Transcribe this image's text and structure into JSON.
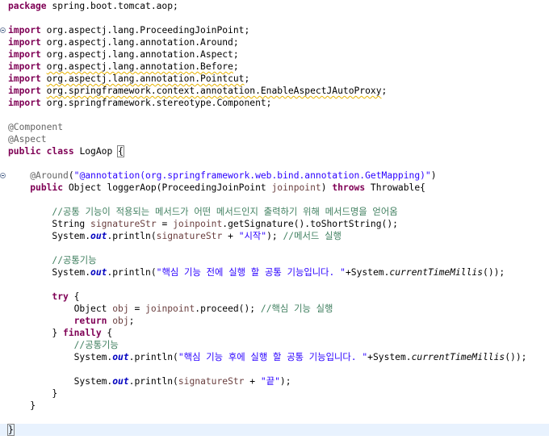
{
  "editor": {
    "lines": [
      {
        "tokens": [
          {
            "c": "kw",
            "t": "package"
          },
          {
            "t": " spring.boot.tomcat.aop;"
          }
        ]
      },
      {
        "tokens": []
      },
      {
        "fold": true,
        "tokens": [
          {
            "c": "kw",
            "t": "import"
          },
          {
            "t": " org.aspectj.lang.ProceedingJoinPoint;"
          }
        ]
      },
      {
        "tokens": [
          {
            "c": "kw",
            "t": "import"
          },
          {
            "t": " org.aspectj.lang.annotation.Around;"
          }
        ]
      },
      {
        "tokens": [
          {
            "c": "kw",
            "t": "import"
          },
          {
            "t": " org.aspectj.lang.annotation.Aspect;"
          }
        ]
      },
      {
        "tokens": [
          {
            "c": "kw",
            "t": "import"
          },
          {
            "t": " "
          },
          {
            "c": "warn",
            "t": "org.aspectj.lang.annotation.Before"
          },
          {
            "t": ";"
          }
        ]
      },
      {
        "tokens": [
          {
            "c": "kw",
            "t": "import"
          },
          {
            "t": " "
          },
          {
            "c": "warn",
            "t": "org.aspectj.lang.annotation.Pointcut"
          },
          {
            "t": ";"
          }
        ]
      },
      {
        "tokens": [
          {
            "c": "kw",
            "t": "import"
          },
          {
            "t": " "
          },
          {
            "c": "warn",
            "t": "org.springframework.context.annotation.EnableAspectJAutoProxy"
          },
          {
            "t": ";"
          }
        ]
      },
      {
        "tokens": [
          {
            "c": "kw",
            "t": "import"
          },
          {
            "t": " org.springframework.stereotype.Component;"
          }
        ]
      },
      {
        "tokens": []
      },
      {
        "tokens": [
          {
            "c": "ann",
            "t": "@Component"
          }
        ]
      },
      {
        "tokens": [
          {
            "c": "ann",
            "t": "@Aspect"
          }
        ]
      },
      {
        "tokens": [
          {
            "c": "kw",
            "t": "public"
          },
          {
            "t": " "
          },
          {
            "c": "kw",
            "t": "class"
          },
          {
            "t": " LogAop "
          },
          {
            "c": "bracket",
            "t": "{"
          }
        ]
      },
      {
        "tokens": []
      },
      {
        "fold": true,
        "tokens": [
          {
            "t": "    "
          },
          {
            "c": "ann",
            "t": "@Around"
          },
          {
            "t": "("
          },
          {
            "c": "str",
            "t": "\"@annotation(org.springframework.web.bind.annotation.GetMapping)\""
          },
          {
            "t": ")"
          }
        ]
      },
      {
        "tokens": [
          {
            "t": "    "
          },
          {
            "c": "kw",
            "t": "public"
          },
          {
            "t": " Object loggerAop(ProceedingJoinPoint "
          },
          {
            "c": "param",
            "t": "joinpoint"
          },
          {
            "t": ") "
          },
          {
            "c": "kw",
            "t": "throws"
          },
          {
            "t": " Throwable{"
          }
        ]
      },
      {
        "tokens": []
      },
      {
        "tokens": [
          {
            "t": "        "
          },
          {
            "c": "cm",
            "t": "//공통 기능이 적용되는 메서드가 어떤 메서드인지 출력하기 위해 메서드명을 얻어옴"
          }
        ]
      },
      {
        "tokens": [
          {
            "t": "        String "
          },
          {
            "c": "param",
            "t": "signatureStr"
          },
          {
            "t": " = "
          },
          {
            "c": "param",
            "t": "joinpoint"
          },
          {
            "t": ".getSignature().toShortString();"
          }
        ]
      },
      {
        "tokens": [
          {
            "t": "        System."
          },
          {
            "c": "field",
            "t": "out"
          },
          {
            "t": ".println("
          },
          {
            "c": "param",
            "t": "signatureStr"
          },
          {
            "t": " + "
          },
          {
            "c": "str",
            "t": "\"시작\""
          },
          {
            "t": "); "
          },
          {
            "c": "cm",
            "t": "//메서드 실행"
          }
        ]
      },
      {
        "tokens": []
      },
      {
        "tokens": [
          {
            "t": "        "
          },
          {
            "c": "cm",
            "t": "//공통기능"
          }
        ]
      },
      {
        "tokens": [
          {
            "t": "        System."
          },
          {
            "c": "field",
            "t": "out"
          },
          {
            "t": ".println("
          },
          {
            "c": "str",
            "t": "\"핵심 기능 전에 실행 할 공통 기능입니다. \""
          },
          {
            "t": "+System."
          },
          {
            "c": "static",
            "t": "currentTimeMillis"
          },
          {
            "t": "());"
          }
        ]
      },
      {
        "tokens": []
      },
      {
        "tokens": [
          {
            "t": "        "
          },
          {
            "c": "kw",
            "t": "try"
          },
          {
            "t": " {"
          }
        ]
      },
      {
        "tokens": [
          {
            "t": "            Object "
          },
          {
            "c": "param",
            "t": "obj"
          },
          {
            "t": " = "
          },
          {
            "c": "param",
            "t": "joinpoint"
          },
          {
            "t": ".proceed(); "
          },
          {
            "c": "cm",
            "t": "//핵심 기능 실행"
          }
        ]
      },
      {
        "tokens": [
          {
            "t": "            "
          },
          {
            "c": "kw",
            "t": "return"
          },
          {
            "t": " "
          },
          {
            "c": "param",
            "t": "obj"
          },
          {
            "t": ";"
          }
        ]
      },
      {
        "tokens": [
          {
            "t": "        } "
          },
          {
            "c": "kw",
            "t": "finally"
          },
          {
            "t": " {"
          }
        ]
      },
      {
        "tokens": [
          {
            "t": "            "
          },
          {
            "c": "cm",
            "t": "//공통기능"
          }
        ]
      },
      {
        "tokens": [
          {
            "t": "            System."
          },
          {
            "c": "field",
            "t": "out"
          },
          {
            "t": ".println("
          },
          {
            "c": "str",
            "t": "\"핵심 기능 후에 실행 할 공통 기능입니다. \""
          },
          {
            "t": "+System."
          },
          {
            "c": "static",
            "t": "currentTimeMillis"
          },
          {
            "t": "());"
          }
        ]
      },
      {
        "tokens": []
      },
      {
        "tokens": [
          {
            "t": "            System."
          },
          {
            "c": "field",
            "t": "out"
          },
          {
            "t": ".println("
          },
          {
            "c": "param",
            "t": "signatureStr"
          },
          {
            "t": " + "
          },
          {
            "c": "str",
            "t": "\"끝\""
          },
          {
            "t": ");"
          }
        ]
      },
      {
        "tokens": [
          {
            "t": "        }"
          }
        ]
      },
      {
        "tokens": [
          {
            "t": "    }"
          }
        ]
      },
      {
        "tokens": []
      },
      {
        "highlight": true,
        "tokens": [
          {
            "c": "bracket",
            "t": "}"
          }
        ]
      },
      {
        "tokens": []
      }
    ]
  },
  "icons": {
    "fold": "collapse-fold-icon"
  }
}
